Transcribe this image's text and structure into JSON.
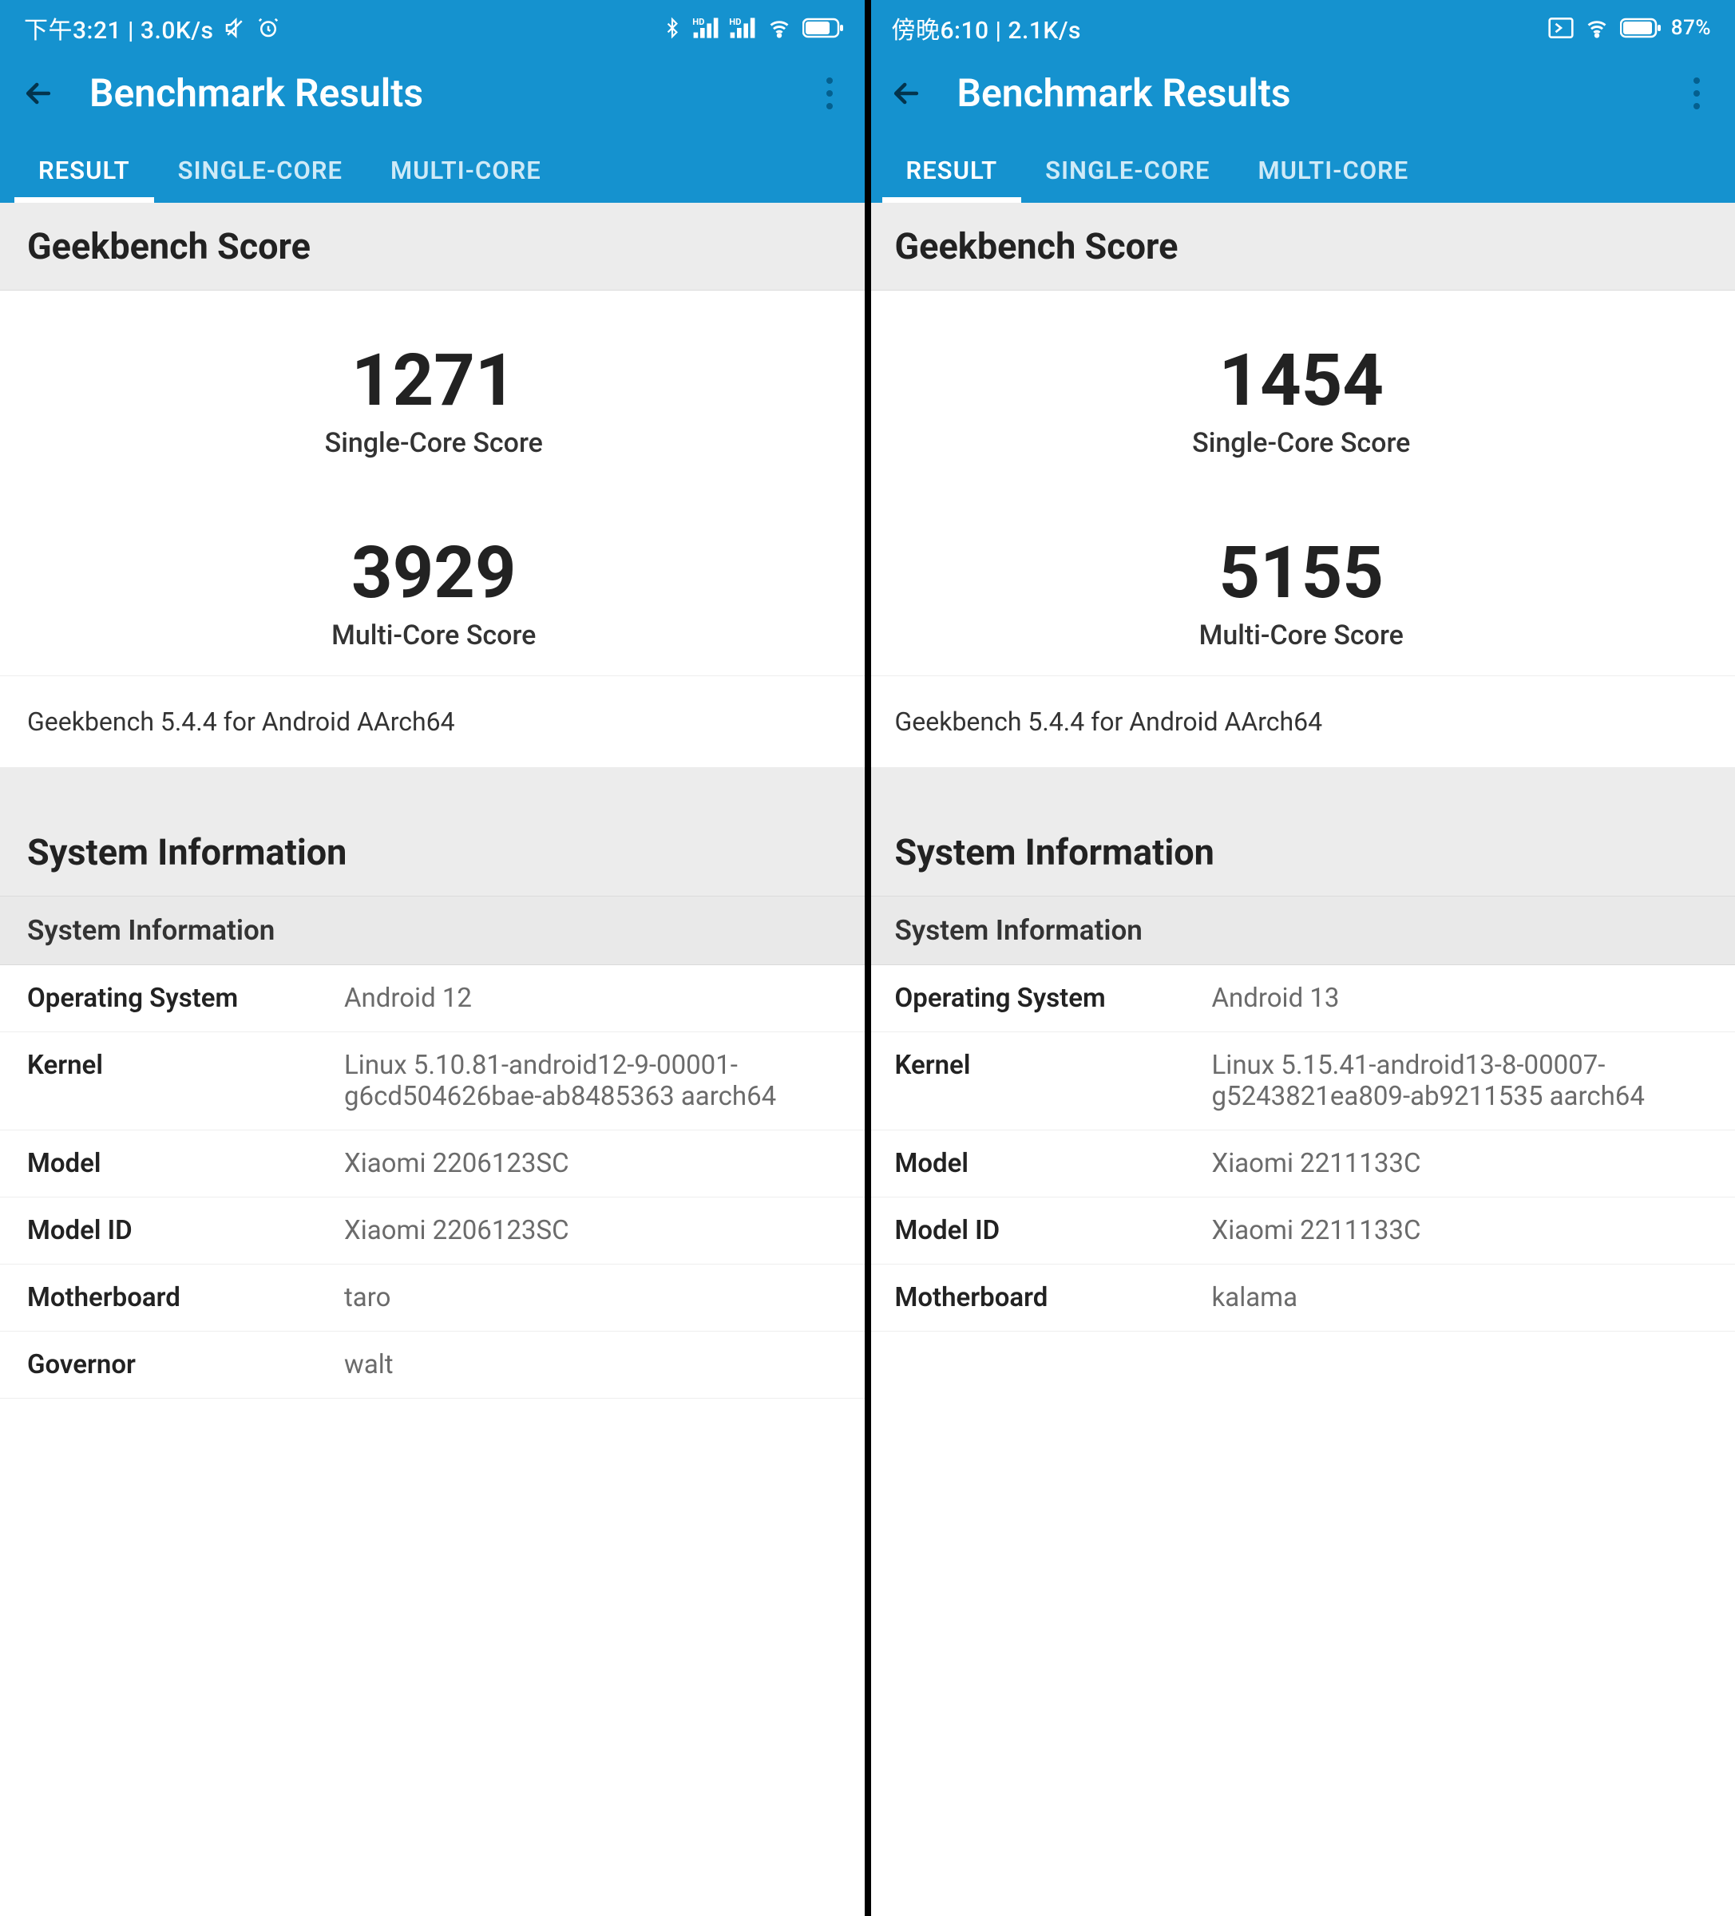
{
  "left": {
    "status": {
      "time": "下午3:21 | 3.0K/s",
      "battery": ""
    },
    "appbar": {
      "title": "Benchmark Results"
    },
    "tabs": {
      "result": "RESULT",
      "single": "SINGLE-CORE",
      "multi": "MULTI-CORE"
    },
    "score_section": "Geekbench Score",
    "single_score": "1271",
    "single_label": "Single-Core Score",
    "multi_score": "3929",
    "multi_label": "Multi-Core Score",
    "version": "Geekbench 5.4.4 for Android AArch64",
    "sys_section": "System Information",
    "sys_sub": "System Information",
    "rows": {
      "os_k": "Operating System",
      "os_v": "Android 12",
      "kernel_k": "Kernel",
      "kernel_v": "Linux 5.10.81-android12-9-00001-g6cd504626bae-ab8485363 aarch64",
      "model_k": "Model",
      "model_v": "Xiaomi 2206123SC",
      "modelid_k": "Model ID",
      "modelid_v": "Xiaomi 2206123SC",
      "mb_k": "Motherboard",
      "mb_v": "taro",
      "gov_k": "Governor",
      "gov_v": "walt"
    }
  },
  "right": {
    "status": {
      "time": "傍晚6:10 | 2.1K/s",
      "battery": "87%"
    },
    "appbar": {
      "title": "Benchmark Results"
    },
    "tabs": {
      "result": "RESULT",
      "single": "SINGLE-CORE",
      "multi": "MULTI-CORE"
    },
    "score_section": "Geekbench Score",
    "single_score": "1454",
    "single_label": "Single-Core Score",
    "multi_score": "5155",
    "multi_label": "Multi-Core Score",
    "version": "Geekbench 5.4.4 for Android AArch64",
    "sys_section": "System Information",
    "sys_sub": "System Information",
    "rows": {
      "os_k": "Operating System",
      "os_v": "Android 13",
      "kernel_k": "Kernel",
      "kernel_v": "Linux 5.15.41-android13-8-00007-g5243821ea809-ab9211535 aarch64",
      "model_k": "Model",
      "model_v": "Xiaomi 2211133C",
      "modelid_k": "Model ID",
      "modelid_v": "Xiaomi 2211133C",
      "mb_k": "Motherboard",
      "mb_v": "kalama"
    }
  }
}
